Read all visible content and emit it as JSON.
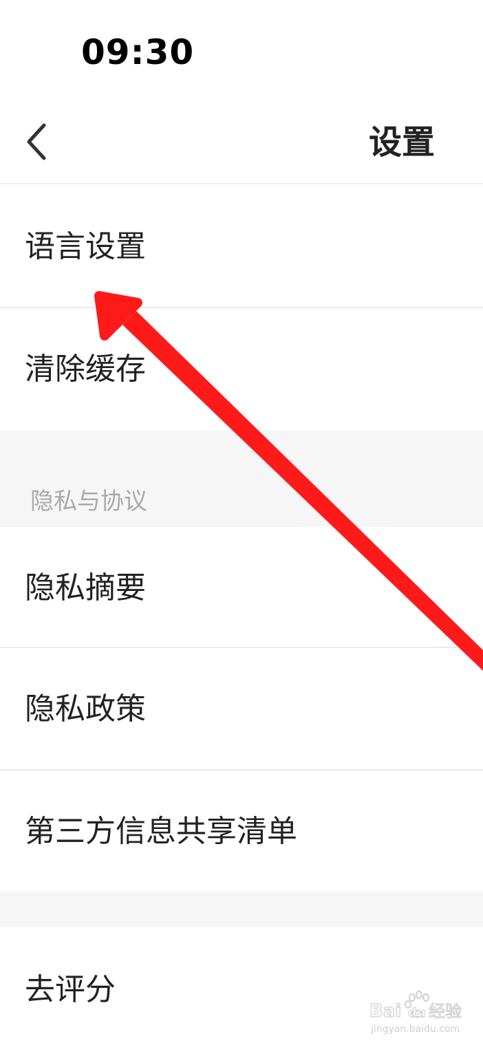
{
  "status_bar": {
    "time": "09:30"
  },
  "nav": {
    "back_icon": "chevron-left-icon",
    "title": "设置"
  },
  "settings": {
    "language": "语言设置",
    "clear_cache": "清除缓存"
  },
  "privacy_section": {
    "title": "隐私与协议",
    "items": [
      {
        "label": "隐私摘要"
      },
      {
        "label": "隐私政策"
      },
      {
        "label": "第三方信息共享清单"
      }
    ]
  },
  "other": {
    "rate": "去评分"
  },
  "annotation": {
    "arrow_color": "#ff1a1a",
    "target": "语言设置"
  },
  "watermark": {
    "brand": "Bai du 经验",
    "url": "jingyan.baidu.com"
  }
}
